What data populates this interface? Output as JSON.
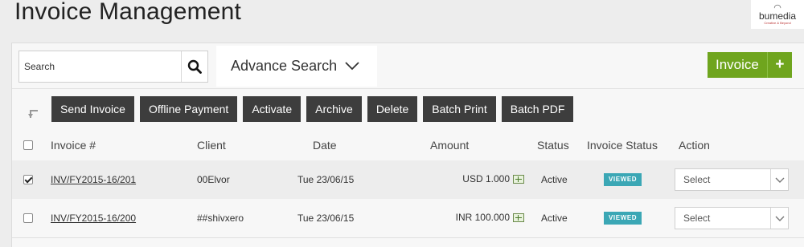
{
  "header": {
    "title": "Invoice Management",
    "logo": {
      "brand": "bumedia",
      "tagline": "Creative & Beyond"
    }
  },
  "search": {
    "placeholder": "Search",
    "icon": "search-icon"
  },
  "advance_search": {
    "label": "Advance Search",
    "icon": "chevron-down-icon"
  },
  "new_invoice": {
    "label": "Invoice",
    "plus": "+",
    "color": "#6fa51e"
  },
  "toolbar": {
    "buttons": [
      "Send Invoice",
      "Offline Payment",
      "Activate",
      "Archive",
      "Delete",
      "Batch Print",
      "Batch PDF"
    ]
  },
  "table": {
    "columns": [
      "Invoice #",
      "Client",
      "Date",
      "Amount",
      "Status",
      "Invoice Status",
      "Action"
    ],
    "rows": [
      {
        "checked": true,
        "invoice": "INV/FY2015-16/201",
        "client": "00Elvor",
        "date": "Tue 23/06/15",
        "amount": "USD 1.000",
        "status": "Active",
        "invoice_status": "VIEWED",
        "action": "Select"
      },
      {
        "checked": false,
        "invoice": "INV/FY2015-16/200",
        "client": "##shivxero",
        "date": "Tue 23/06/15",
        "amount": "INR 100.000",
        "status": "Active",
        "invoice_status": "VIEWED",
        "action": "Select"
      }
    ]
  },
  "colors": {
    "badge": "#3ba7b5",
    "toolbar_button": "#3d3d3d"
  }
}
